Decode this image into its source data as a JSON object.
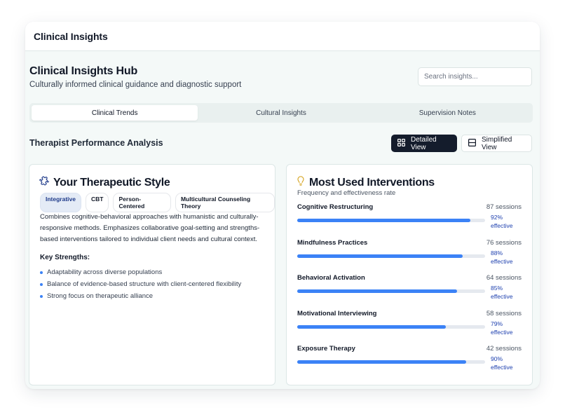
{
  "app": {
    "title": "Clinical Insights"
  },
  "hub": {
    "title": "Clinical Insights Hub",
    "subtitle": "Culturally informed clinical guidance and diagnostic support"
  },
  "search": {
    "placeholder": "Search insights..."
  },
  "tabs": [
    {
      "label": "Clinical Trends",
      "active": true
    },
    {
      "label": "Cultural Insights",
      "active": false
    },
    {
      "label": "Supervision Notes",
      "active": false
    }
  ],
  "section": {
    "title": "Therapist Performance Analysis",
    "detailed_label": "Detailed View",
    "simplified_label": "Simplified View"
  },
  "style_card": {
    "title": "Your Therapeutic Style",
    "icon": "puzzle-icon",
    "badges": [
      "Integrative",
      "CBT",
      "Person-Centered",
      "Multicultural Counseling Theory"
    ],
    "description": "Combines cognitive-behavioral approaches with humanistic and culturally-responsive methods. Emphasizes collaborative goal-setting and strengths-based interventions tailored to individual client needs and cultural context.",
    "strengths_title": "Key Strengths:",
    "strengths": [
      "Adaptability across diverse populations",
      "Balance of evidence-based structure with client-centered flexibility",
      "Strong focus on therapeutic alliance"
    ]
  },
  "interventions_card": {
    "title": "Most Used Interventions",
    "icon": "lightbulb-icon",
    "subtitle": "Frequency and effectiveness rate",
    "items": [
      {
        "name": "Cognitive Restructuring",
        "sessions": "87 sessions",
        "effective_pct": "92%",
        "effective_word": "effective",
        "bar_fraction": 0.92
      },
      {
        "name": "Mindfulness Practices",
        "sessions": "76 sessions",
        "effective_pct": "88%",
        "effective_word": "effective",
        "bar_fraction": 0.88
      },
      {
        "name": "Behavioral Activation",
        "sessions": "64 sessions",
        "effective_pct": "85%",
        "effective_word": "effective",
        "bar_fraction": 0.85
      },
      {
        "name": "Motivational Interviewing",
        "sessions": "58 sessions",
        "effective_pct": "79%",
        "effective_word": "effective",
        "bar_fraction": 0.79
      },
      {
        "name": "Exposure Therapy",
        "sessions": "42 sessions",
        "effective_pct": "90%",
        "effective_word": "effective",
        "bar_fraction": 0.9
      }
    ]
  },
  "colors": {
    "accent": "#3b82f6",
    "primary_button": "#141c2c",
    "background": "#f4f9f8"
  }
}
